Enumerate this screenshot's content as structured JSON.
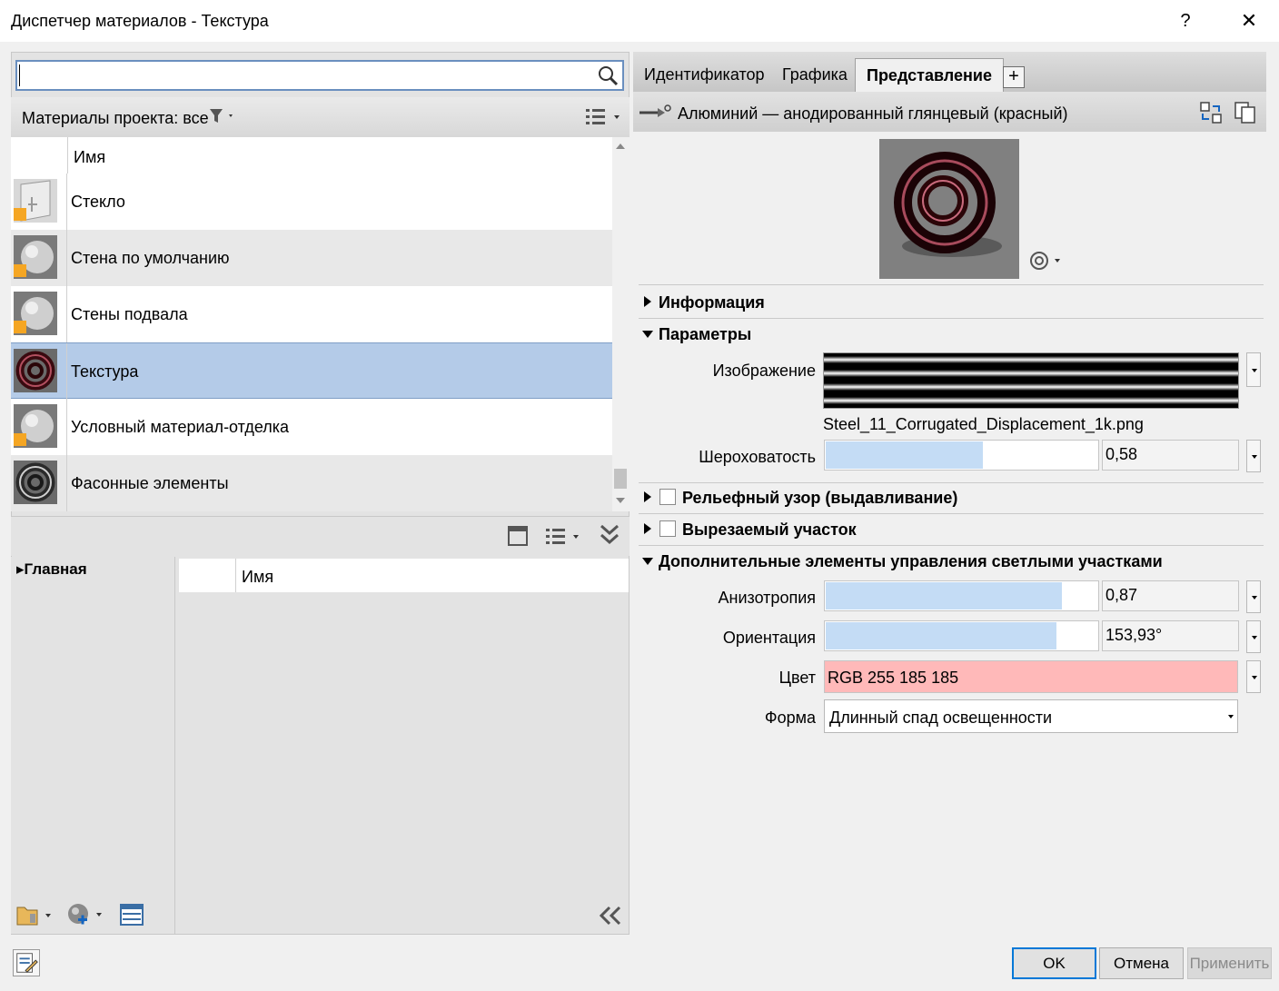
{
  "window": {
    "title": "Диспетчер материалов - Текстура",
    "help": "?",
    "close": "✕"
  },
  "search": {
    "placeholder": "",
    "value": ""
  },
  "project_materials": {
    "label": "Материалы проекта: все",
    "column_name": "Имя",
    "items": [
      {
        "name": "Стекло",
        "icon": "glass-thumb",
        "warning": true,
        "selected": false
      },
      {
        "name": "Стена по умолчанию",
        "icon": "sphere-thumb",
        "warning": true,
        "selected": false
      },
      {
        "name": "Стены подвала",
        "icon": "sphere-thumb",
        "warning": true,
        "selected": false
      },
      {
        "name": "Текстура",
        "icon": "torus-red-thumb",
        "warning": false,
        "selected": true
      },
      {
        "name": "Условный материал-отделка",
        "icon": "sphere-thumb",
        "warning": true,
        "selected": false
      },
      {
        "name": "Фасонные элементы",
        "icon": "torus-gray-thumb",
        "warning": false,
        "selected": false
      }
    ]
  },
  "library": {
    "tree_item": "Главная",
    "column_name": "Имя"
  },
  "tabs": {
    "identity": "Идентификатор",
    "graphics": "Графика",
    "appearance": "Представление",
    "add": "+"
  },
  "asset": {
    "name": "Алюминий — анодированный глянцевый (красный)"
  },
  "sections": {
    "info": "Информация",
    "params": "Параметры",
    "relief": "Рельефный узор (выдавливание)",
    "cutout": "Вырезаемый участок",
    "highlights": "Дополнительные элементы управления светлыми участками"
  },
  "params": {
    "image_label": "Изображение",
    "image_file": "Steel_11_Corrugated_Displacement_1k.png",
    "roughness_label": "Шероховатость",
    "roughness_value": "0,58",
    "roughness": 0.58
  },
  "highlights": {
    "anisotropy_label": "Анизотропия",
    "anisotropy_value": "0,87",
    "anisotropy": 0.87,
    "orientation_label": "Ориентация",
    "orientation_value": "153,93°",
    "orientation_fraction": 0.85,
    "color_label": "Цвет",
    "color_value": "RGB 255 185 185",
    "color_hex": "#ffb9b9",
    "shape_label": "Форма",
    "shape_value": "Длинный спад освещенности"
  },
  "footer": {
    "ok": "OK",
    "cancel": "Отмена",
    "apply": "Применить"
  },
  "colors": {
    "selection": "#b4cbe8",
    "slider_fill": "#c4dcf5",
    "accent": "#0078d7"
  }
}
